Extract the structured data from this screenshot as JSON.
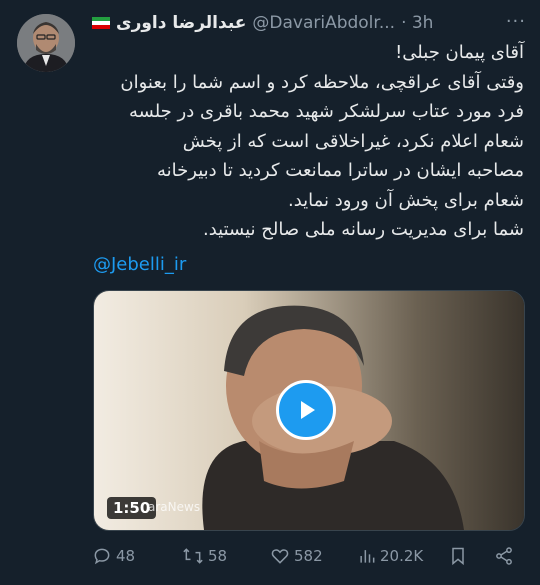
{
  "tweet": {
    "display_name": "عبدالرضا داوری",
    "handle": "@DavariAbdolr...",
    "time": "· 3h",
    "more_label": "···",
    "text_lines": [
      "آقای پیمان جبلی!",
      "وقتی آقای عراقچی، ملاحظه کرد و اسم شما را بعنوان",
      "فرد مورد عتاب سرلشکر شهید محمد باقری در جلسه",
      "شعام اعلام نکرد، غیراخلاقی است که از پخش",
      "مصاحبه ایشان در ساترا ممانعت کردید تا دبیرخانه",
      "شعام برای پخش آن ورود نماید.",
      "شما برای مدیریت رسانه ملی صالح نیستید."
    ],
    "mention": "@Jebelli_ir",
    "flag_colors": [
      "#239f40",
      "#ffffff",
      "#da0000"
    ]
  },
  "video": {
    "duration": "1:50",
    "watermark": "araNews"
  },
  "actions": {
    "replies": "48",
    "retweets": "58",
    "likes": "582",
    "views": "20.2K"
  },
  "colors": {
    "background": "#15202b",
    "text": "#e7e9ea",
    "secondary": "#8b98a5",
    "accent": "#1d9bf0"
  }
}
